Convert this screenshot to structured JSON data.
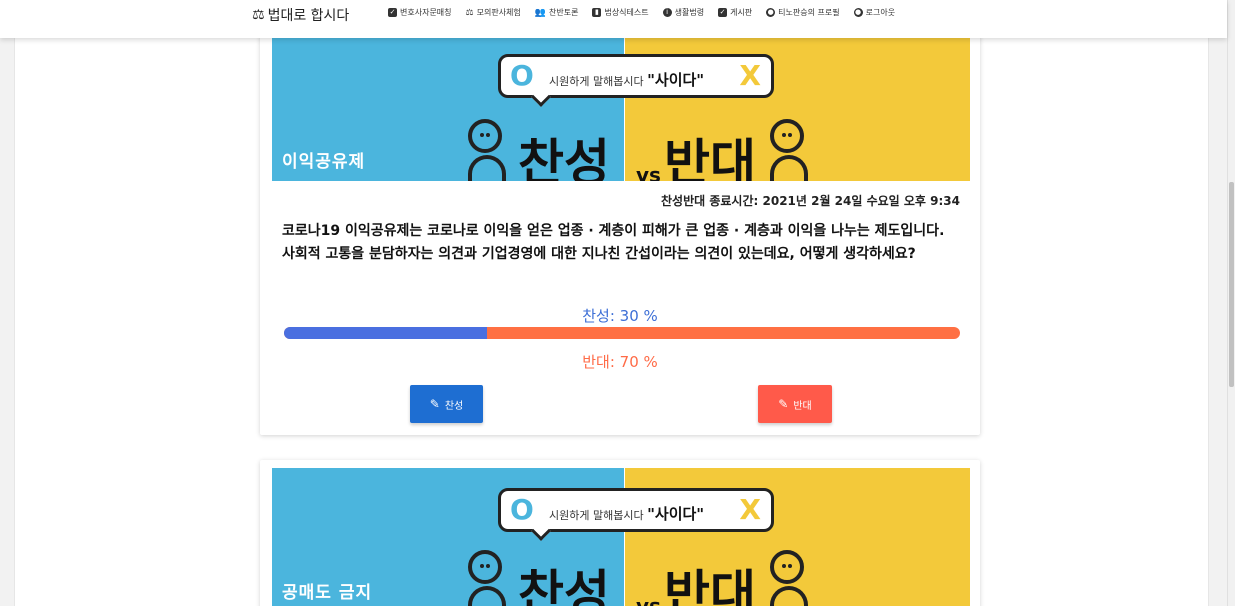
{
  "brand": {
    "icon": "gavel-icon",
    "title": "법대로 합시다"
  },
  "nav": [
    {
      "icon": "checkbox-icon",
      "label": "변호사자문매칭"
    },
    {
      "icon": "gavel-icon",
      "label": "모의판사체험"
    },
    {
      "icon": "people-icon",
      "label": "찬반토론"
    },
    {
      "icon": "book-icon",
      "label": "법상식테스트"
    },
    {
      "icon": "info-icon",
      "label": "생활법령"
    },
    {
      "icon": "checkbox-icon",
      "label": "게시판"
    },
    {
      "icon": "user-icon",
      "label": "티노판승의 프로필"
    },
    {
      "icon": "user-icon",
      "label": "로그아웃"
    }
  ],
  "colors": {
    "pro": "#4a6fe0",
    "con": "#ff7043",
    "banner_left": "#4bb5dd",
    "banner_right": "#f3c93a"
  },
  "banner": {
    "o_mark": "O",
    "x_mark": "X",
    "bubble_text": "시원하게 말해봅시다",
    "bubble_emph": "\"사이다\"",
    "pro_word": "찬성",
    "vs": "vs",
    "con_word": "반대"
  },
  "debates": [
    {
      "topic": "이익공유제",
      "deadline": "찬성반대 종료시간: 2021년 2월 24일 수요일 오후 9:34",
      "question": "코로나19 이익공유제는 코로나로 이익을 얻은 업종 · 계층이 피해가 큰 업종 · 계층과 이익을 나누는 제도입니다. 사회적 고통을 분담하자는 의견과 기업경영에 대한 지나친 간섭이라는 의견이 있는데요, 어떻게 생각하세요?",
      "pro_label": "찬성: 30 %",
      "con_label": "반대: 70 %",
      "pro_percent": 30,
      "pro_button": "찬성",
      "con_button": "반대"
    },
    {
      "topic": "공매도 금지"
    }
  ]
}
